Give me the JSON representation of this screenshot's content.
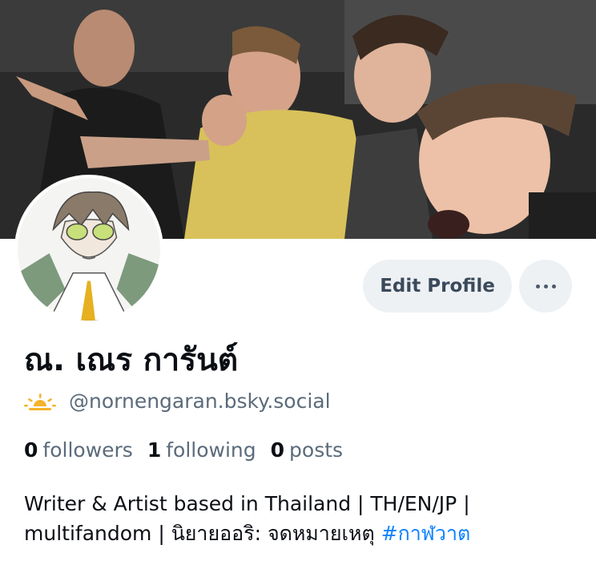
{
  "profile": {
    "display_name": "ณ. เณร การันต์",
    "handle": "@nornengaran.bsky.social",
    "handle_icon": "sun-horizon-icon",
    "banner_description": "photo-banner",
    "avatar_description": "illustrated-avatar"
  },
  "actions": {
    "edit_profile_label": "Edit Profile",
    "more_icon": "more-dots-icon"
  },
  "stats": {
    "followers_count": "0",
    "followers_label": "followers",
    "following_count": "1",
    "following_label": "following",
    "posts_count": "0",
    "posts_label": "posts"
  },
  "bio": {
    "line1": "Writer & Artist based in Thailand | TH/EN/JP |",
    "line2_text": "multifandom | นิยายออริ: จดหมายเหตุ ",
    "hashtag": "#กาฬวาต"
  },
  "colors": {
    "accent": "#1083fe",
    "button_bg": "#eef1f4",
    "muted_text": "#5b6b7b"
  }
}
